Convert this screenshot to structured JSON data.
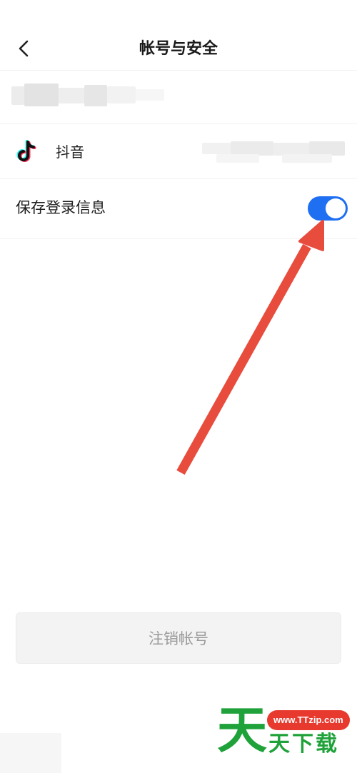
{
  "header": {
    "title": "帐号与安全",
    "back_icon": "chevron-left-icon"
  },
  "account": {
    "name_redacted": true
  },
  "linked_accounts": [
    {
      "icon": "douyin-icon",
      "label": "抖音",
      "value_redacted": true
    }
  ],
  "settings": {
    "save_login_label": "保存登录信息",
    "save_login_enabled": true,
    "toggle_color": "#1f6ff2"
  },
  "actions": {
    "deactivate_label": "注销帐号"
  },
  "annotation": {
    "arrow_color": "#e84c3d"
  },
  "watermark": {
    "big_char": "天",
    "url": "www.TTzip.com",
    "text": "天下载"
  }
}
